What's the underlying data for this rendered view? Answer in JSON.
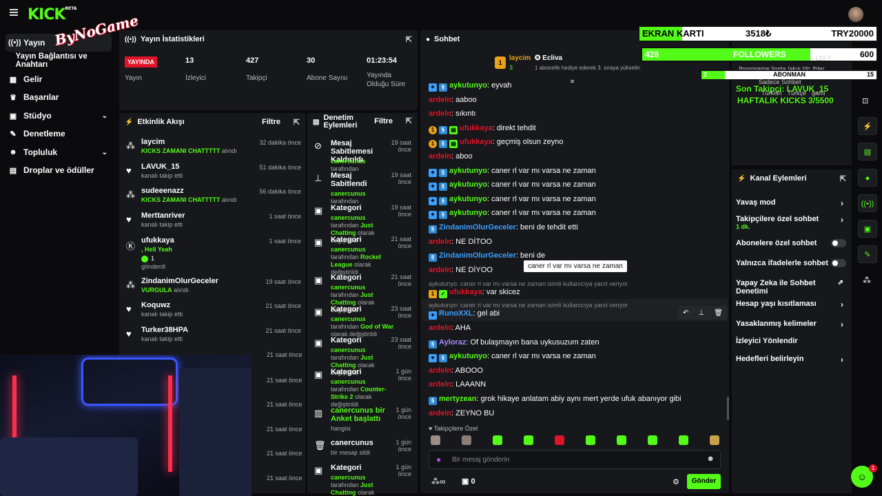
{
  "brand": {
    "logo": "KICK",
    "logo_sup": "BETA",
    "watermark": "ByNoGame"
  },
  "sidebar": [
    {
      "label": "Yayın",
      "icon": "broadcast-icon"
    },
    {
      "label": "Yayın Bağlantısı ve Anahtarı",
      "icon": ""
    },
    {
      "label": "Gelir",
      "icon": "chart-icon"
    },
    {
      "label": "Başarılar",
      "icon": "trophy-icon"
    },
    {
      "label": "Stüdyo",
      "icon": "studio-icon"
    },
    {
      "label": "Denetleme",
      "icon": "wrench-icon"
    },
    {
      "label": "Topluluk",
      "icon": "community-icon"
    },
    {
      "label": "Droplar ve ödüller",
      "icon": "gift-icon"
    }
  ],
  "stats": {
    "title": "Yayın İstatistikleri",
    "live_badge": "YAYINDA",
    "live_label": "Yayın",
    "viewers": "13",
    "viewers_label": "İzleyici",
    "followers": "427",
    "followers_label": "Takipçi",
    "subs": "30",
    "subs_label": "Abone Sayısı",
    "uptime": "01:23:54",
    "uptime_label": "Yayında Olduğu Süre"
  },
  "activity": {
    "title": "Etkinlik Akışı",
    "filter": "Filtre",
    "items": [
      {
        "name": "laycim",
        "sub": "KICKS ZAMANI CHATTTTT",
        "suffix": " alındı",
        "time": "32 dakika önce",
        "icon": "kicks-icon"
      },
      {
        "name": "LAVUK_15",
        "sub": "kanalı takip etti",
        "suffix": "",
        "time": "51 dakika önce",
        "icon": "heart-icon"
      },
      {
        "name": "sudeeenazz",
        "sub": "KICKS ZAMANI CHATTTTT",
        "suffix": " alındı",
        "time": "56 dakika önce",
        "icon": "kicks-icon"
      },
      {
        "name": "Merttanriver",
        "sub": "kanalı takip etti",
        "suffix": "",
        "time": "1 saat önce",
        "icon": "heart-icon"
      },
      {
        "name": "ufukkaya",
        "sub": ", Hell Yeah",
        "suffix": "",
        "time": "1 saat önce",
        "icon": "kick-icon"
      },
      {
        "name": "ZindanimOlurGeceler",
        "sub": "VURGULA",
        "suffix": " alındı",
        "time": "19 saat önce",
        "icon": "kicks-icon"
      },
      {
        "name": "Koquwz",
        "sub": "kanalı takip etti",
        "suffix": "",
        "time": "21 saat önce",
        "icon": "heart-icon"
      },
      {
        "name": "Turker38HPA",
        "sub": "kanalı takip etti",
        "suffix": "",
        "time": "21 saat önce",
        "icon": "heart-icon"
      }
    ],
    "ufuk_extra": "1",
    "ufuk_sent": "gönderdi",
    "hidden_times": [
      "21 saat önce",
      "21 saat önce",
      "21 saat önce",
      "21 saat önce",
      "21 saat önce",
      "21 saat önce"
    ]
  },
  "moderation": {
    "title": "Denetim Eylemleri",
    "filter": "Filtre",
    "items": [
      {
        "name": "Mesaj Sabitlemesi Kaldırıldı",
        "time": "19 saat önce",
        "by": "canercunus",
        "rest": " tarafından",
        "icon": "unpin-icon"
      },
      {
        "name": "Mesaj Sabitlendi",
        "time": "19 saat önce",
        "by": "canercunus",
        "rest": " tarafından",
        "icon": "pin-icon"
      },
      {
        "name": "Kategori",
        "time": "19 saat önce",
        "by": "canercunus",
        "rest": " tarafından ",
        "cat": "Just Chatting",
        "tail": " olarak değiştirildi",
        "icon": "category-icon"
      },
      {
        "name": "Kategori",
        "time": "21 saat önce",
        "by": "canercunus",
        "rest": " tarafından ",
        "cat": "Rocket League",
        "tail": " olarak değiştirildi",
        "icon": "category-icon"
      },
      {
        "name": "Kategori",
        "time": "21 saat önce",
        "by": "canercunus",
        "rest": " tarafından ",
        "cat": "Just Chatting",
        "tail": " olarak değiştirildi",
        "icon": "category-icon"
      },
      {
        "name": "Kategori",
        "time": "23 saat önce",
        "by": "canercunus",
        "rest": " tarafından ",
        "cat": "God of War",
        "tail": " olarak değiştirildi",
        "icon": "category-icon"
      },
      {
        "name": "Kategori",
        "time": "23 saat önce",
        "by": "canercunus",
        "rest": " tarafından ",
        "cat": "Just Chatting",
        "tail": " olarak değiştirildi",
        "icon": "category-icon"
      },
      {
        "name": "Kategori",
        "time": "1 gün önce",
        "by": "canercunus",
        "rest": " tarafından ",
        "cat": "Counter-Strike 2",
        "tail": " olarak değiştirildi",
        "icon": "category-icon"
      },
      {
        "name": "canercunus bir Anket başlattı",
        "time": "1 gün önce",
        "by": "",
        "rest": "hangisi",
        "icon": "poll-icon"
      },
      {
        "name": "canercunus",
        "time": "1 gün önce",
        "by": "",
        "rest": "bir mesajı sildi",
        "icon": "trash-icon"
      },
      {
        "name": "Kategori",
        "time": "1 gün önce",
        "by": "canercunus",
        "rest": " tarafından ",
        "cat": "Just Chatting",
        "tail": " olarak değiştirildi",
        "icon": "category-icon"
      }
    ]
  },
  "chat": {
    "title": "Sohbet",
    "top_user": "laycim",
    "top_count": "3",
    "gift_user": "Ecliva",
    "gift_text": "1 abonelik hediye ederek 3. sıraya yükselin",
    "messages": [
      {
        "user": "aykutunyo",
        "text": "eyvah",
        "color": "#53fc18",
        "badges": [
          "mod",
          "sub"
        ]
      },
      {
        "user": "ardeln",
        "text": "aaboo",
        "color": "#e0132a",
        "badges": []
      },
      {
        "user": "ardeln",
        "text": "sıkıntı",
        "color": "#e0132a",
        "badges": []
      },
      {
        "user": "ufukkaya",
        "text": "direkt tehdit",
        "color": "#e0132a",
        "badges": [
          "gold",
          "sub",
          "gift"
        ]
      },
      {
        "user": "ufukkaya",
        "text": "geçmiş olsun zeyno",
        "color": "#e0132a",
        "badges": [
          "gold",
          "sub",
          "gift"
        ]
      },
      {
        "user": "ardeln",
        "text": "aboo",
        "color": "#e0132a",
        "badges": []
      },
      {
        "user": "aykutunyo",
        "text": "caner rl var mı varsa ne zaman",
        "color": "#53fc18",
        "badges": [
          "mod",
          "sub"
        ]
      },
      {
        "user": "aykutunyo",
        "text": "caner rl var mı varsa ne zaman",
        "color": "#53fc18",
        "badges": [
          "mod",
          "sub"
        ]
      },
      {
        "user": "aykutunyo",
        "text": "caner rl var mı varsa ne zaman",
        "color": "#53fc18",
        "badges": [
          "mod",
          "sub"
        ]
      },
      {
        "user": "aykutunyo",
        "text": "caner rl var mı varsa ne zaman",
        "color": "#53fc18",
        "badges": [
          "mod",
          "sub"
        ]
      },
      {
        "user": "ZindanimOlurGeceler",
        "text": "beni de tehdit etti",
        "color": "#3aa0ff",
        "badges": [
          "sub"
        ]
      },
      {
        "user": "ardeln",
        "text": "NE DİTOO",
        "color": "#e0132a",
        "badges": []
      },
      {
        "user": "ZindanimOlurGeceler",
        "text": "beni de",
        "color": "#3aa0ff",
        "badges": [
          "sub"
        ]
      },
      {
        "user": "ardeln",
        "text": "NE DİYOO",
        "color": "#e0132a",
        "badges": []
      }
    ],
    "tooltip": "caner rl var mı varsa ne zaman",
    "reply1": "aykutunyo: caner rl var mı varsa ne zaman isimli kullanıcıya yanıt veriyor",
    "reply_msg1": {
      "user": "ufukkaya",
      "text": "var skicez"
    },
    "reply2": "aykutunyo: caner rl var mı varsa ne zaman isimli kullanıcıya yanıt veriyor",
    "reply_msg2": {
      "user": "RunoXXL",
      "text": "gel abi"
    },
    "messages2": [
      {
        "user": "ardeln",
        "text": "AHA",
        "color": "#e0132a",
        "badges": []
      },
      {
        "user": "Ayloraz",
        "text": "Of bulaşmayın bana uykusuzum zaten",
        "color": "#a98cff",
        "badges": [
          "sub"
        ]
      },
      {
        "user": "aykutunyo",
        "text": "caner rl var mı varsa ne zaman",
        "color": "#53fc18",
        "badges": [
          "mod",
          "sub"
        ]
      },
      {
        "user": "ardeln",
        "text": "ABOOO",
        "color": "#e0132a",
        "badges": []
      },
      {
        "user": "ardeln",
        "text": "LAAANN",
        "color": "#e0132a",
        "badges": []
      },
      {
        "user": "mertyzean",
        "text": "grok hikaye anlatam abiy aynı mert yerde ufuk abanıyor gibi",
        "color": "#53fc18",
        "badges": [
          "sub"
        ]
      },
      {
        "user": "ardeln",
        "text": "ZEYNO BU",
        "color": "#e0132a",
        "badges": []
      }
    ],
    "followers_only": "Takipçilere Özel",
    "input_placeholder": "Bir mesaj gönderin",
    "points": "0",
    "infinity": "∞",
    "send": "Gönder"
  },
  "overlay": {
    "ekran_label": "EKRAN KARTI",
    "ekran_value": "3518₺",
    "ekran_goal": "TRY20000",
    "followers_count": "428",
    "followers_label": "FOLLOWERS",
    "followers_goal": "600",
    "sub_now": "2",
    "sub_label": "ABONMAN",
    "sub_goal": "15",
    "last_follower": "Son Takipçi: LAVUK_15",
    "weekly_kicks": "HAFTALIK KICKS 3/5500",
    "partial_text": "LDİ ?",
    "partial_text2": "!bynogame !insta !akıs !dc !bler...",
    "tags": [
      "Türkish",
      "Türkçe",
      "gami"
    ],
    "subs_only": "Sadece Sohbet"
  },
  "channel": {
    "title": "Kanal Eylemleri",
    "items": [
      {
        "label": "Yavaş mod",
        "type": "chev"
      },
      {
        "label": "Takipçilere özel sohbet",
        "type": "chev",
        "sub": "1 dk."
      },
      {
        "label": "Abonelere özel sohbet",
        "type": "toggle"
      },
      {
        "label": "Yalnızca ifadelerle sohbet",
        "type": "toggle"
      },
      {
        "label": "Yapay Zeka ile Sohbet Denetimi",
        "type": "ext"
      },
      {
        "label": "Hesap yaşı kısıtlaması",
        "type": "chev"
      },
      {
        "label": "Yasaklanmış kelimeler",
        "type": "chev"
      },
      {
        "label": "İzleyici Yönlendir",
        "type": "none"
      },
      {
        "label": "Hedefleri belirleyin",
        "type": "chev"
      }
    ]
  },
  "support_badge": "1",
  "colors": {
    "accent": "#53fc18",
    "live": "#e0132a",
    "panel": "#17181b",
    "bg": "#0b0b0d"
  }
}
